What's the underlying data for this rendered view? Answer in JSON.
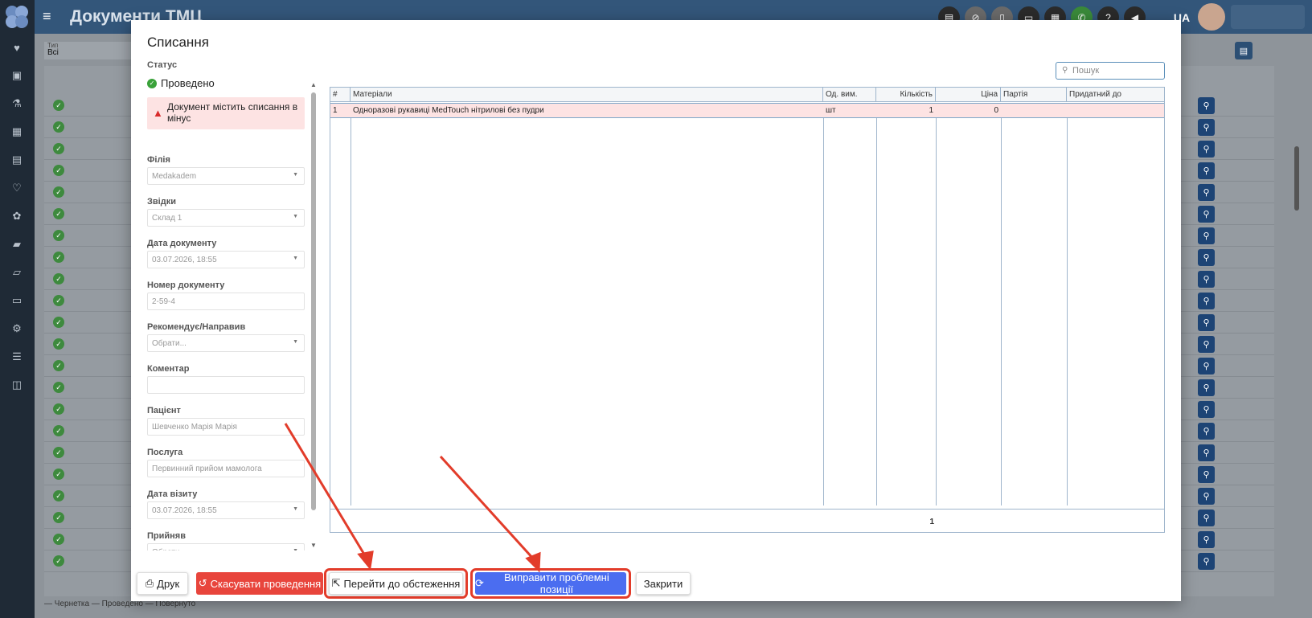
{
  "app": {
    "title": "Документи ТМЦ",
    "lang": "UA",
    "filter_label": "Тип",
    "filter_value": "Всі",
    "legend": "— Чернетка   — Проведено   — Повернуто"
  },
  "sidebar_icons": [
    "heart-icon",
    "card-icon",
    "flask-icon",
    "calendar-icon",
    "document-icon",
    "heartbeat-icon",
    "pills-icon",
    "book-icon",
    "folder-icon",
    "cash-icon",
    "gears-icon",
    "list-icon",
    "note-icon"
  ],
  "modal": {
    "title": "Списання",
    "status_label": "Статус",
    "status_value": "Проведено",
    "warning": "Документ містить списання в мінус",
    "fields": [
      {
        "label": "Філія",
        "value": "Medakadem",
        "select": true
      },
      {
        "label": "Звідки",
        "value": "Склад 1",
        "select": true
      },
      {
        "label": "Дата документу",
        "value": "03.07.2026, 18:55",
        "select": true
      },
      {
        "label": "Номер документу",
        "value": "2-59-4",
        "select": false
      },
      {
        "label": "Рекомендує/Направив",
        "value": "Обрати...",
        "select": true
      },
      {
        "label": "Коментар",
        "value": "",
        "select": false
      },
      {
        "label": "Пацієнт",
        "value": "Шевченко Марія Марія",
        "select": false
      },
      {
        "label": "Послуга",
        "value": "Первинний прийом мамолога",
        "select": false
      },
      {
        "label": "Дата візиту",
        "value": "03.07.2026, 18:55",
        "select": true
      },
      {
        "label": "Прийняв",
        "value": "Обрати...",
        "select": true
      }
    ],
    "search_placeholder": "Пошук",
    "table": {
      "columns": [
        "#",
        "Матеріали",
        "Од. вим.",
        "Кількість",
        "Ціна",
        "Партія",
        "Придатний до"
      ],
      "rows": [
        {
          "n": "1",
          "material": "Одноразові рукавиці MedTouch нітрилові без пудри",
          "unit": "шт",
          "qty": "1",
          "price": "0",
          "batch": "",
          "expiry": ""
        }
      ],
      "total_qty": "1"
    },
    "buttons": {
      "print": "Друк",
      "cancel_post": "Скасувати проведення",
      "go_exam": "Перейти до обстеження",
      "fix": "Виправити проблемні позиції",
      "close": "Закрити"
    }
  },
  "colors": {
    "accent_red": "#e8453c",
    "accent_blue": "#4b6df0",
    "annotation": "#e23c2a",
    "topbar": "#33567a",
    "sidebar": "#1f2a36"
  }
}
